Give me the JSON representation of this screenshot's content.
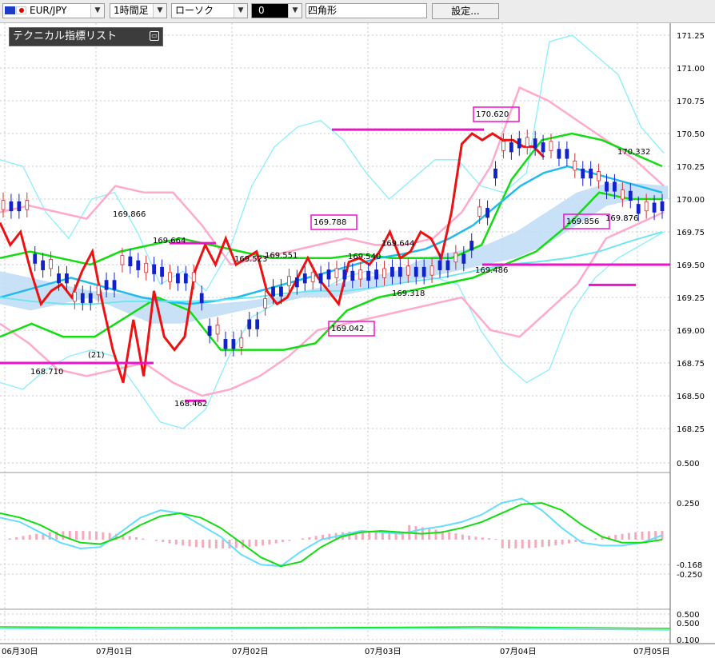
{
  "toolbar": {
    "symbol": "EUR/JPY",
    "timeframe": "1時間足",
    "chart_style": "ローソク",
    "mode": "0",
    "draw_tool": "四角形",
    "settings_label": "設定...",
    "dropdown_icon": "chevron-down-icon"
  },
  "indicator_panel": {
    "label": "テクニカル指標リスト",
    "button_icon": "maximize-icon"
  },
  "colors": {
    "red_line": "#ee1111",
    "green_line": "#11dd11",
    "blue_line": "#22bbee",
    "bollinger_pink": "#ffaacc",
    "bollinger_cyan": "#88eeff",
    "cloud": "#bfdcf5",
    "cloud_pink": "#f9d3e4",
    "magenta": "#ee11cc",
    "candle_up": "#cc3333",
    "candle_down": "#1122cc",
    "macd_bar": "#f5aabb"
  },
  "chart_data": [
    {
      "type": "candlestick",
      "title": "",
      "x_ticks": [
        "06月30日",
        "07月01日",
        "07月02日",
        "07月03日",
        "07月04日",
        "07月05日"
      ],
      "y_ticks": [
        "171.25",
        "171.00",
        "170.75",
        "170.50",
        "170.25",
        "170.00",
        "169.75",
        "169.50",
        "169.25",
        "169.00",
        "168.75",
        "168.50",
        "168.25"
      ],
      "ylim": [
        168.25,
        171.25
      ],
      "annotations": [
        {
          "text": "169.866",
          "value": 169.866
        },
        {
          "text": "169.664",
          "value": 169.664
        },
        {
          "text": "168.710",
          "value": 168.71
        },
        {
          "text": "(21)",
          "value": 168.8
        },
        {
          "text": "168.462",
          "value": 168.462
        },
        {
          "text": "169.523",
          "value": 169.523
        },
        {
          "text": "169.551",
          "value": 169.551
        },
        {
          "text": "169.788",
          "value": 169.788,
          "boxed": true
        },
        {
          "text": "169.540",
          "value": 169.54
        },
        {
          "text": "169.644",
          "value": 169.644
        },
        {
          "text": "169.318",
          "value": 169.318
        },
        {
          "text": "169.042",
          "value": 169.042,
          "boxed": true
        },
        {
          "text": "170.620",
          "value": 170.62,
          "boxed": true
        },
        {
          "text": "169.486",
          "value": 169.486
        },
        {
          "text": "169.856",
          "value": 169.856,
          "boxed": true
        },
        {
          "text": "169.876",
          "value": 169.876
        },
        {
          "text": "170.332",
          "value": 170.332
        }
      ],
      "horizontal_levels": [
        168.71,
        168.75,
        169.664,
        168.462,
        170.53,
        169.5,
        169.345
      ],
      "series": [
        {
          "values": [
            169.82,
            169.65,
            169.75,
            169.45,
            169.2,
            169.3,
            169.35,
            169.25,
            169.45,
            169.6,
            169.2,
            168.85,
            168.6,
            169.08,
            168.65,
            169.3,
            168.95,
            168.85,
            168.95,
            169.45,
            169.65,
            169.5,
            169.7,
            169.5,
            169.55,
            169.6,
            169.3,
            169.2,
            169.25,
            169.4,
            169.55,
            169.4,
            169.3,
            169.2,
            169.52,
            169.55,
            169.5,
            169.6,
            169.75,
            169.55,
            169.6,
            169.75,
            169.7,
            169.55,
            169.9,
            170.42,
            170.5,
            170.45,
            170.5,
            170.45,
            170.45,
            170.4,
            170.4,
            170.32,
            170.1,
            170.0,
            169.95,
            170.0,
            170.1,
            170.15,
            170.0,
            169.95,
            170.05,
            170.12,
            170.0,
            170.15,
            170.2,
            170.05,
            170.12,
            170.15,
            170.2,
            170.25
          ]
        },
        {
          "values": [
            170.0,
            170.0,
            169.6,
            169.55,
            169.45,
            169.3,
            169.3,
            169.35,
            169.4,
            169.58,
            169.55,
            169.52,
            169.5,
            169.45,
            169.45,
            169.3,
            169.05,
            168.95,
            168.95,
            169.1,
            169.25,
            169.35,
            169.42,
            169.45,
            169.45,
            169.48,
            169.48,
            169.47,
            169.47,
            169.48,
            169.5,
            169.5,
            169.5,
            169.5,
            169.55,
            169.6,
            169.7,
            169.95,
            170.25,
            170.45,
            170.48,
            170.48,
            170.45,
            170.4,
            170.3,
            170.25,
            170.22,
            170.15,
            170.08,
            169.98,
            169.99,
            170.0
          ]
        },
        {
          "values": [
            169.25,
            169.3,
            169.35,
            169.4,
            169.35,
            169.3,
            169.25,
            169.22,
            169.2,
            169.22,
            169.25,
            169.3,
            169.35,
            169.4,
            169.45,
            169.5,
            169.55,
            169.58,
            169.62,
            169.7,
            169.8,
            169.95,
            170.1,
            170.2,
            170.25,
            170.2,
            170.15,
            170.1,
            170.05
          ]
        },
        {
          "values": [
            169.45,
            169.45,
            169.2,
            169.25,
            169.2,
            168.95,
            168.95,
            168.95,
            168.95,
            168.95,
            169.1,
            169.05,
            169.0,
            168.9,
            168.85,
            168.85,
            168.85,
            168.85,
            169.0,
            169.05,
            169.05,
            169.15,
            169.2,
            169.25,
            169.3,
            169.3,
            169.45,
            169.45,
            169.45,
            169.5,
            169.55,
            169.6,
            169.85,
            170.0,
            170.05,
            170.1,
            170.15,
            170.15,
            170.05,
            169.95,
            169.95,
            169.98
          ]
        }
      ]
    },
    {
      "type": "macd",
      "title": "",
      "y_ticks": [
        "0.500",
        "0.250",
        "-0.168",
        "-0.250"
      ],
      "ylim": [
        -0.35,
        0.55
      ],
      "series": [
        {
          "values": [
            0.15,
            0.12,
            0.05,
            -0.02,
            -0.06,
            -0.05,
            0.05,
            0.15,
            0.2,
            0.18,
            0.1,
            0.02,
            -0.1,
            -0.17,
            -0.18,
            -0.08,
            0.0,
            0.03,
            0.06,
            0.05,
            0.04,
            0.07,
            0.09,
            0.12,
            0.17,
            0.25,
            0.28,
            0.2,
            0.08,
            -0.02,
            -0.04,
            -0.04,
            -0.02,
            0.03
          ]
        },
        {
          "values": [
            0.18,
            0.15,
            0.1,
            0.03,
            -0.02,
            -0.03,
            0.02,
            0.1,
            0.16,
            0.18,
            0.15,
            0.08,
            -0.02,
            -0.12,
            -0.18,
            -0.15,
            -0.05,
            0.02,
            0.05,
            0.06,
            0.05,
            0.04,
            0.05,
            0.08,
            0.12,
            0.18,
            0.24,
            0.25,
            0.2,
            0.1,
            0.02,
            -0.02,
            -0.02,
            0.0
          ]
        }
      ]
    },
    {
      "type": "oscillator",
      "title": "",
      "y_ticks": [
        "0.500",
        "0.500",
        "0.100"
      ],
      "ylim": [
        0.0,
        0.6
      ]
    }
  ]
}
